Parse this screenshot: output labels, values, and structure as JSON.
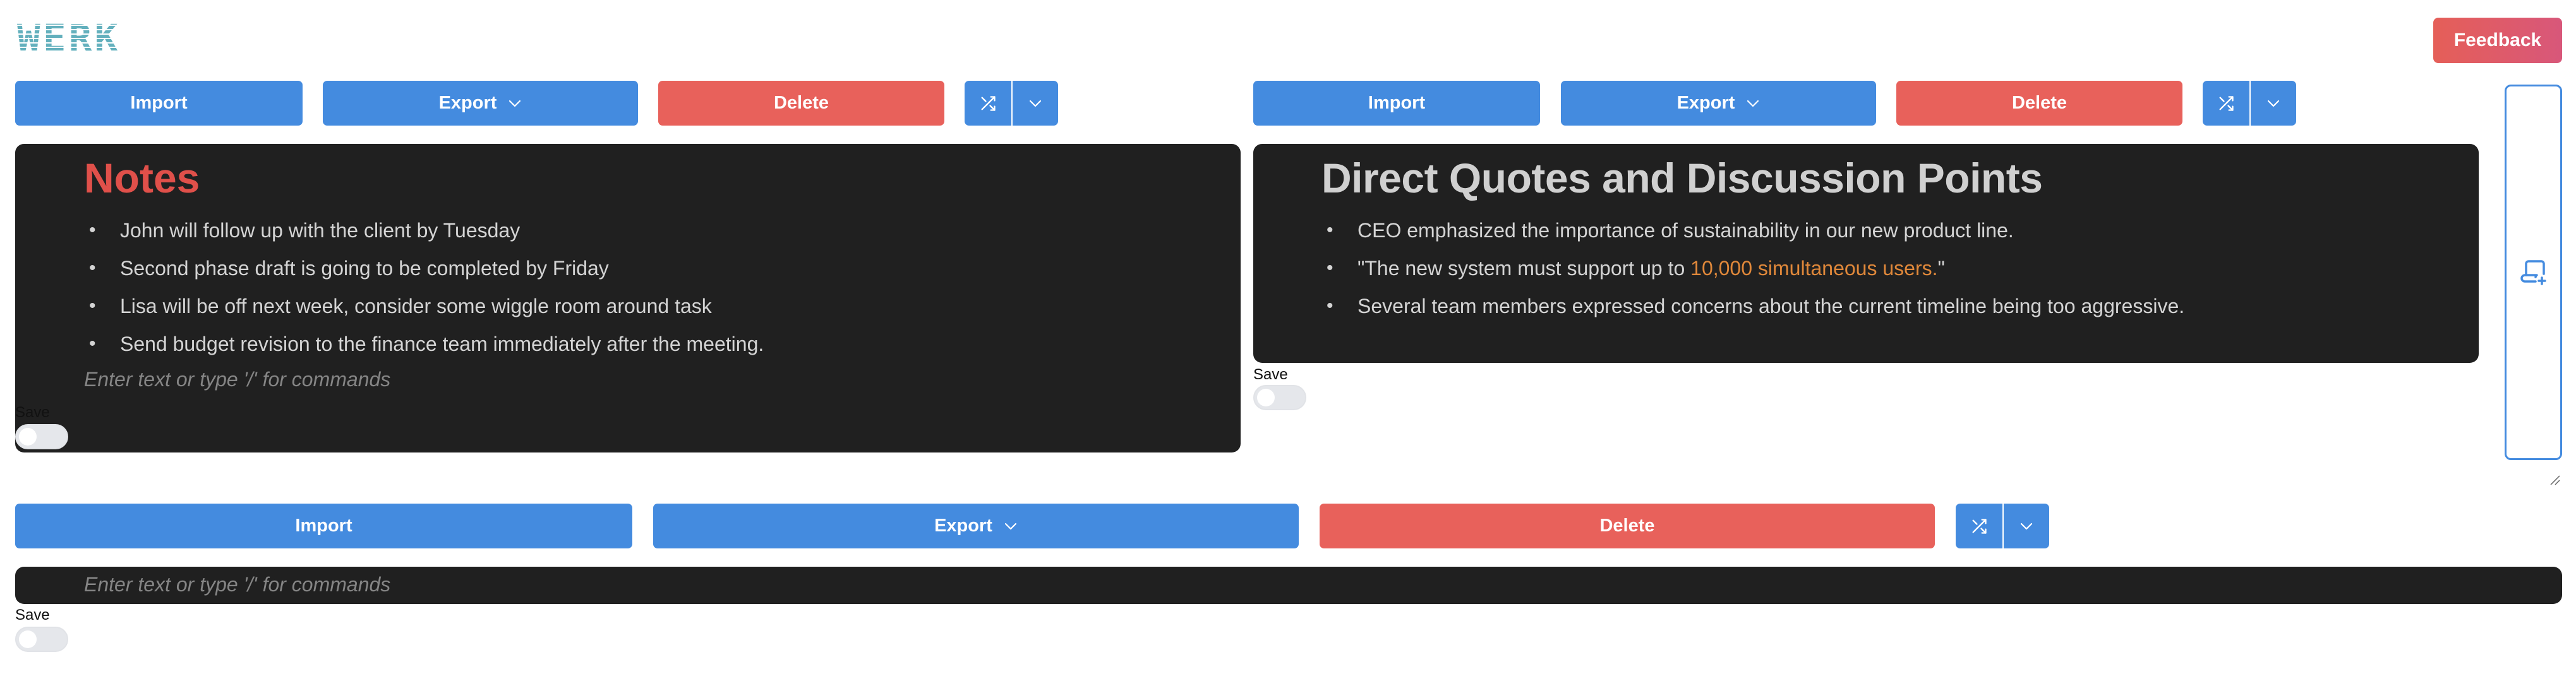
{
  "app": {
    "logo_text": "WERK",
    "feedback_label": "Feedback"
  },
  "colors": {
    "primary_blue": "#448bdf",
    "danger_red": "#e8615b",
    "editor_bg": "#202020",
    "logo_teal": "#63b0bd",
    "notes_heading": "#e0504a",
    "highlight_orange": "#e0883a"
  },
  "blocks": [
    {
      "toolbar": {
        "import_label": "Import",
        "export_label": "Export",
        "delete_label": "Delete",
        "shuffle_icon": "shuffle-icon",
        "more_icon": "chevron-down-icon"
      },
      "heading": "Notes",
      "items": [
        "John will follow up with the client by Tuesday",
        "Second phase draft is going to be completed by Friday",
        "Lisa will be off next week, consider some wiggle room around task",
        "Send budget revision to the finance team immediately after the meeting."
      ],
      "placeholder": "Enter text or type '/' for commands",
      "save_label": "Save",
      "save_enabled": false
    },
    {
      "toolbar": {
        "import_label": "Import",
        "export_label": "Export",
        "delete_label": "Delete",
        "shuffle_icon": "shuffle-icon",
        "more_icon": "chevron-down-icon"
      },
      "heading": "Direct Quotes and Discussion Points",
      "items": [
        {
          "text": "CEO emphasized the importance of sustainability in our new product line."
        },
        {
          "text_before": "\"The new system must support up to ",
          "highlight": "10,000 simultaneous users.",
          "text_after": "\""
        },
        {
          "text": "Several team members expressed concerns about the current timeline being too aggressive."
        }
      ],
      "save_label": "Save",
      "save_enabled": false
    },
    {
      "toolbar": {
        "import_label": "Import",
        "export_label": "Export",
        "delete_label": "Delete",
        "shuffle_icon": "shuffle-icon",
        "more_icon": "chevron-down-icon"
      },
      "placeholder": "Enter text or type '/' for commands",
      "save_label": "Save",
      "save_enabled": false
    }
  ],
  "side_panel": {
    "icon": "add-script-icon"
  }
}
